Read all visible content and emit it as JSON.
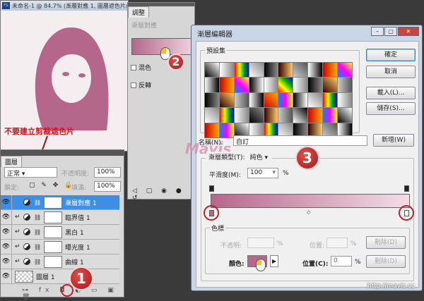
{
  "document": {
    "title": "未命名-1 @ 84.7% (漸層對應 1, 圖層遮色片/8) *",
    "app_icon": "Ps"
  },
  "annotation": {
    "text": "不要建立剪裁遮色片",
    "color": "#d4141c",
    "steps": [
      "1",
      "2",
      "3"
    ]
  },
  "adjustments": {
    "tab": "調整",
    "title": "漸層對應",
    "dither": "混色",
    "reverse": "反轉",
    "gradient": [
      "#b5678b",
      "#f1d6e2"
    ]
  },
  "gradient_editor": {
    "title": "漸層編輯器",
    "presets_label": "預設集",
    "ok": "確定",
    "cancel": "取消",
    "load": "載入(L)...",
    "save": "儲存(S)...",
    "name_label": "名稱(N):",
    "name_value": "自訂",
    "new": "新增(W)",
    "type_label": "漸層類型(T):",
    "type_value": "純色",
    "smooth_label": "平滑度(M):",
    "smooth_value": "100",
    "pct": "%",
    "gradient": [
      "#b5678b",
      "#f3dde6"
    ],
    "stops_group": "色標",
    "opacity_label": "不透明:",
    "opacity_value": "",
    "location_label": "位置:",
    "delete": "刪除(D)",
    "color_label": "顏色:",
    "color_value": "#b5678b",
    "location_c_label": "位置(C):",
    "location_c_value": "0"
  },
  "watermark": {
    "logo": "Mavis",
    "url": "http://mavis.cc"
  },
  "layers": {
    "tab": "圖層",
    "blend": "正常",
    "opacity_label": "不透明度:",
    "opacity": "100%",
    "lock_label": "鎖定:",
    "fill_label": "填滿:",
    "fill": "100%",
    "items": [
      {
        "name": "漸層對應 1",
        "selected": true
      },
      {
        "name": "臨界值 1"
      },
      {
        "name": "黑白 1"
      },
      {
        "name": "曝光度 1"
      },
      {
        "name": "曲線 1"
      },
      {
        "name": "圖層 1",
        "photo": true
      }
    ]
  }
}
